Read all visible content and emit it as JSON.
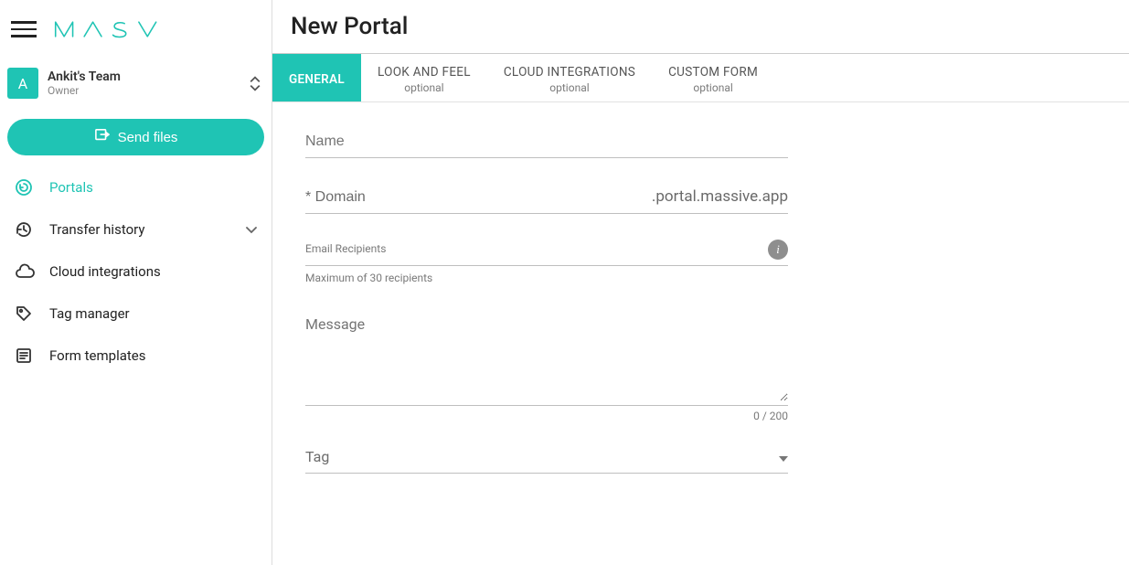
{
  "logo_text": "MASV",
  "team": {
    "avatar_letter": "A",
    "name": "Ankit's Team",
    "role": "Owner"
  },
  "send_button_label": "Send files",
  "sidebar": {
    "items": [
      {
        "label": "Portals"
      },
      {
        "label": "Transfer history"
      },
      {
        "label": "Cloud integrations"
      },
      {
        "label": "Tag manager"
      },
      {
        "label": "Form templates"
      }
    ]
  },
  "main": {
    "title": "New Portal",
    "tabs": [
      {
        "label": "GENERAL",
        "optional": ""
      },
      {
        "label": "LOOK AND FEEL",
        "optional": "optional"
      },
      {
        "label": "CLOUD INTEGRATIONS",
        "optional": "optional"
      },
      {
        "label": "CUSTOM FORM",
        "optional": "optional"
      }
    ],
    "form": {
      "name_placeholder": "Name",
      "domain_placeholder": "* Domain",
      "domain_suffix": ".portal.massive.app",
      "email_label": "Email Recipients",
      "email_helper": "Maximum of 30 recipients",
      "message_placeholder": "Message",
      "char_count": "0 / 200",
      "tag_placeholder": "Tag"
    }
  }
}
